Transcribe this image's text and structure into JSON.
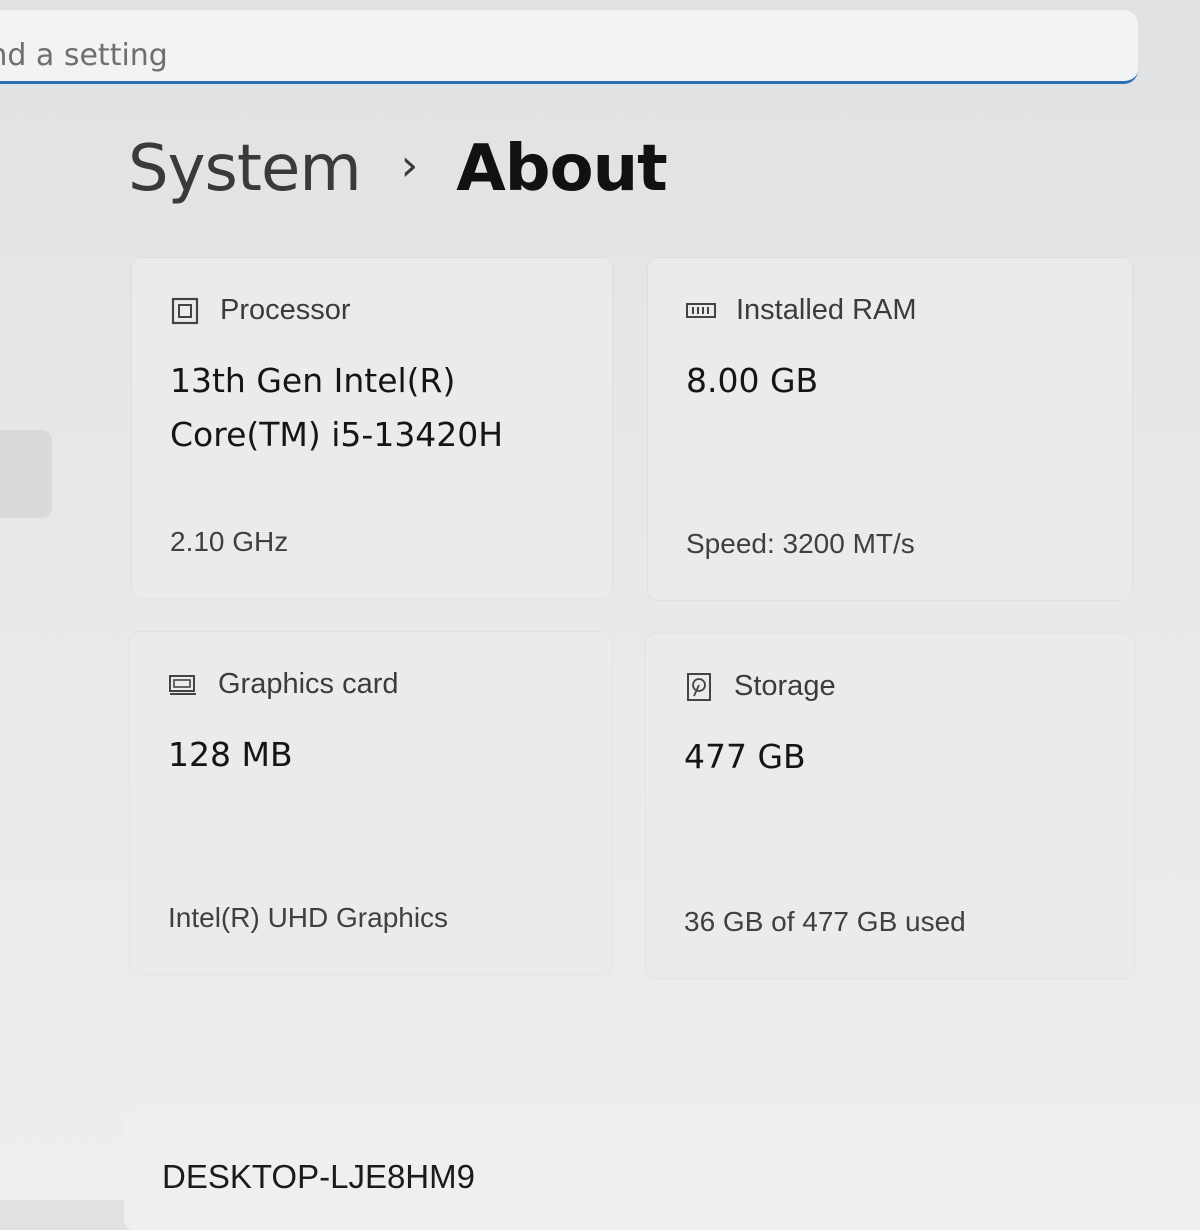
{
  "search": {
    "placeholder": "ind a setting"
  },
  "breadcrumb": {
    "parent": "System",
    "separator": "›",
    "current": "About"
  },
  "cards": {
    "processor": {
      "icon": "processor-icon",
      "title": "Processor",
      "value_line1": "13th Gen Intel(R)",
      "value_line2": "Core(TM) i5-13420H",
      "detail": "2.10 GHz"
    },
    "ram": {
      "icon": "ram-icon",
      "title": "Installed RAM",
      "value": "8.00 GB",
      "detail": "Speed: 3200 MT/s"
    },
    "graphics": {
      "icon": "graphics-card-icon",
      "title": "Graphics card",
      "value": "128 MB",
      "detail": "Intel(R) UHD Graphics"
    },
    "storage": {
      "icon": "storage-icon",
      "title": "Storage",
      "value": "477 GB",
      "detail": "36 GB of 477 GB used"
    }
  },
  "device": {
    "name": "DESKTOP-LJE8HM9"
  },
  "colors": {
    "accent": "#2d6fb6"
  }
}
